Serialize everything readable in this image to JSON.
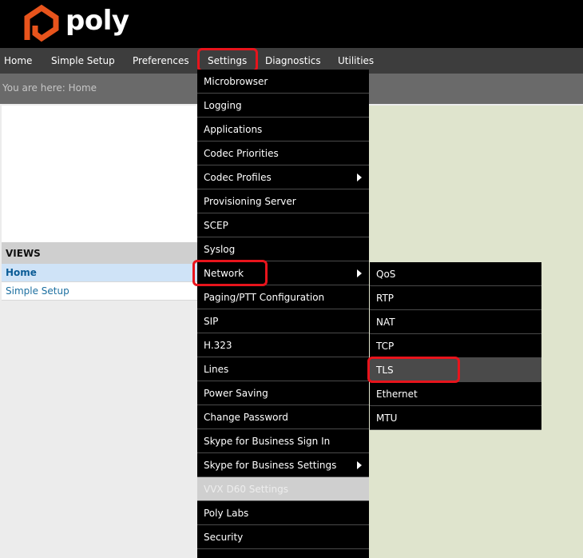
{
  "brand": {
    "name": "poly",
    "accent_color": "#e8541c",
    "highlight_color": "#e8141c"
  },
  "nav": [
    {
      "label": "Home"
    },
    {
      "label": "Simple Setup"
    },
    {
      "label": "Preferences"
    },
    {
      "label": "Settings"
    },
    {
      "label": "Diagnostics"
    },
    {
      "label": "Utilities"
    }
  ],
  "breadcrumb": "You are here: Home",
  "views": {
    "header": "VIEWS",
    "items": [
      {
        "label": "Home"
      },
      {
        "label": "Simple Setup"
      }
    ]
  },
  "settings_menu": [
    {
      "label": "Microbrowser"
    },
    {
      "label": "Logging"
    },
    {
      "label": "Applications"
    },
    {
      "label": "Codec Priorities"
    },
    {
      "label": "Codec Profiles",
      "submenu_icon": "triangle-right-icon"
    },
    {
      "label": "Provisioning Server"
    },
    {
      "label": "SCEP"
    },
    {
      "label": "Syslog"
    },
    {
      "label": "Network",
      "submenu_icon": "triangle-right-icon"
    },
    {
      "label": "Paging/PTT Configuration"
    },
    {
      "label": "SIP"
    },
    {
      "label": "H.323"
    },
    {
      "label": "Lines"
    },
    {
      "label": "Power Saving"
    },
    {
      "label": "Change Password"
    },
    {
      "label": "Skype for Business Sign In"
    },
    {
      "label": "Skype for Business Settings",
      "submenu_icon": "triangle-right-icon"
    },
    {
      "label": "VVX D60 Settings",
      "disabled": true
    },
    {
      "label": "Poly Labs"
    },
    {
      "label": "Security"
    }
  ],
  "network_submenu": [
    {
      "label": "QoS"
    },
    {
      "label": "RTP"
    },
    {
      "label": "NAT"
    },
    {
      "label": "TCP"
    },
    {
      "label": "TLS"
    },
    {
      "label": "Ethernet"
    },
    {
      "label": "MTU"
    }
  ]
}
